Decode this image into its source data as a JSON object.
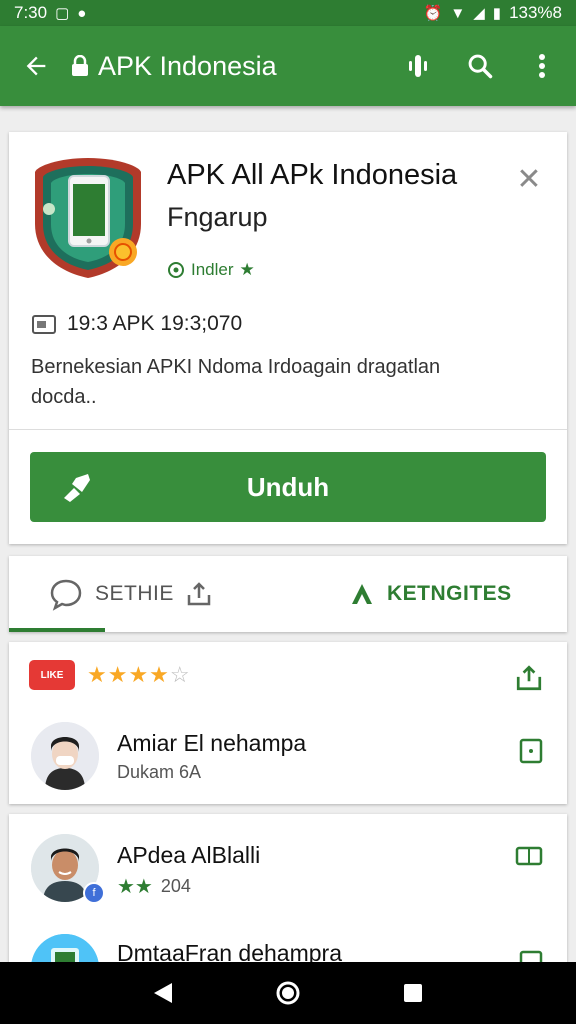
{
  "status_bar": {
    "time": "7:30",
    "battery": "133%8"
  },
  "app_bar": {
    "title": "APK Indonesia"
  },
  "app": {
    "title": "APK All APk Indonesia",
    "subtitle": "Fngarup",
    "installed_label": "Indler",
    "meta": "19:3 APK 19:3;070",
    "description": "Bernekesian APKI Ndoma Irdoagain dragatlan docda..",
    "download_label": "Unduh"
  },
  "tabs": [
    {
      "label": "SETHIE"
    },
    {
      "label": "KETNGITES"
    }
  ],
  "reviews": {
    "badge": "LIKE",
    "rating": 4,
    "max_rating": 5,
    "users": [
      {
        "name": "Amiar El nehampa",
        "sub": "Dukam 6A"
      },
      {
        "name": "APdea AlBlalli",
        "sub": "204",
        "stars": 2
      },
      {
        "name": "DmtaaFran dehampra",
        "sub": ""
      }
    ]
  },
  "colors": {
    "primary": "#388e3c",
    "primary_dark": "#2e7d32",
    "star": "#f9a825",
    "badge": "#e53935"
  },
  "icons": [
    "back-arrow-icon",
    "lock-icon",
    "voice-icon",
    "search-icon",
    "more-vert-icon",
    "close-icon",
    "install-check-icon",
    "calendar-icon",
    "download-icon",
    "chat-icon",
    "share-icon",
    "android-icon",
    "bookmark-icon",
    "back-nav-icon",
    "home-nav-icon",
    "recents-nav-icon"
  ]
}
